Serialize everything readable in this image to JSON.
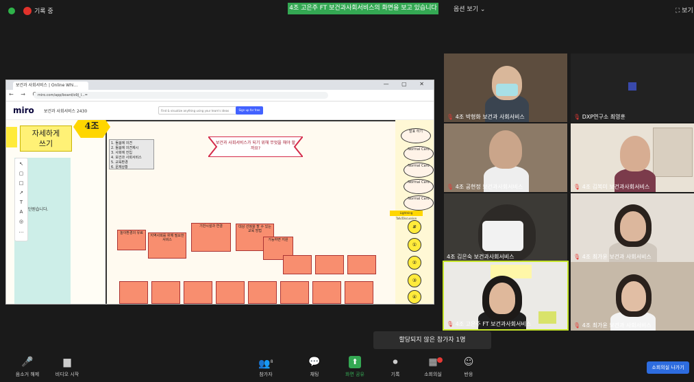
{
  "top": {
    "recording_label": "기록 중",
    "share_banner": "4조 고은주 FT 보건과사회서비스의 화면을 보고 있습니다",
    "view_label": "옵션 보기 ⌄",
    "fullscreen_label": "⛶ 보기"
  },
  "browser": {
    "tab_title": "보건과 사회서비스 | Online Whi...",
    "window_controls": "— ▢ ✕",
    "nav_buttons": "← → C",
    "url": "miro.com/app/board/o9J_l...="
  },
  "miro": {
    "logo": "miro",
    "board_name": "보건과 사회서비스 2430",
    "search_placeholder": "Find & visualize anything using your team's ideas",
    "signup_label": "Sign up for free",
    "tools": [
      "↖",
      "▢",
      "□",
      "↗",
      "T",
      "A",
      "◎",
      "…"
    ]
  },
  "board": {
    "detail_sticky": "자세하게\n쓰기",
    "group_label": "4조",
    "cyan_text": "단원습니다.",
    "list_sticky": "1. 돌봄에 의견\n2. 돌봄에 의견제시\n3. 사회에 진입\n4. 보건과 사회서비스\n5. 교육환경\n6. 문제상황",
    "banner_text": "보건과 사회서비스가 되기 위해 무엇을 해야 할까요?",
    "boxes": [
      "놀이환경의 유료",
      "지역사회를 위해 필요한 서비스",
      "기반시설과 연결",
      "대상 선정을 할 수 있는 교육 방법",
      "가능하면 지원",
      "",
      "",
      "",
      "",
      "",
      "",
      "",
      "",
      "",
      "",
      "",
      "",
      "",
      ""
    ],
    "ovals": [
      "발표 하기",
      "Normal Card",
      "Normal Card",
      "Normal Card",
      "Normal Card"
    ],
    "circles": [
      "#",
      "①",
      "②",
      "③",
      "④",
      "⑤"
    ],
    "tag": "Lightning Talk/Discussion"
  },
  "gallery": [
    {
      "name": "4조 박형화 보건과 사회서비스"
    },
    {
      "name": "DXP연구소 최영훈"
    },
    {
      "name": "4조 공현정 보건과사회서비스"
    },
    {
      "name": "4조 김복미 보건과사회서비스"
    },
    {
      "name": "4조 김은숙 보건과사회서비스"
    },
    {
      "name": "4조 최가윤 보건과 사회서비스"
    },
    {
      "name": "4조 고은주 FT 보건과사회서비스"
    },
    {
      "name": "4조 최가윤 보건과 사회서비스"
    }
  ],
  "notice": "할당되지 않은 참가자 1명",
  "bottom": {
    "buttons": [
      {
        "icon": "🎤",
        "label": "음소거 해제"
      },
      {
        "icon": "▆",
        "label": "비디오 시작"
      },
      {
        "icon": "👥",
        "label": "참가자"
      },
      {
        "icon": "💬",
        "label": "채팅"
      },
      {
        "icon": "⬆",
        "label": "화면 공유"
      },
      {
        "icon": "⏺",
        "label": "기록"
      },
      {
        "icon": "▦",
        "label": "소회의실"
      },
      {
        "icon": "☺",
        "label": "반응"
      }
    ],
    "participant_count": "8",
    "leave_label": "소회의실 나가기"
  },
  "colors": {
    "accent": "#2d6cdf",
    "share_green": "#34a853",
    "sticky_salmon": "#f88e6f"
  }
}
